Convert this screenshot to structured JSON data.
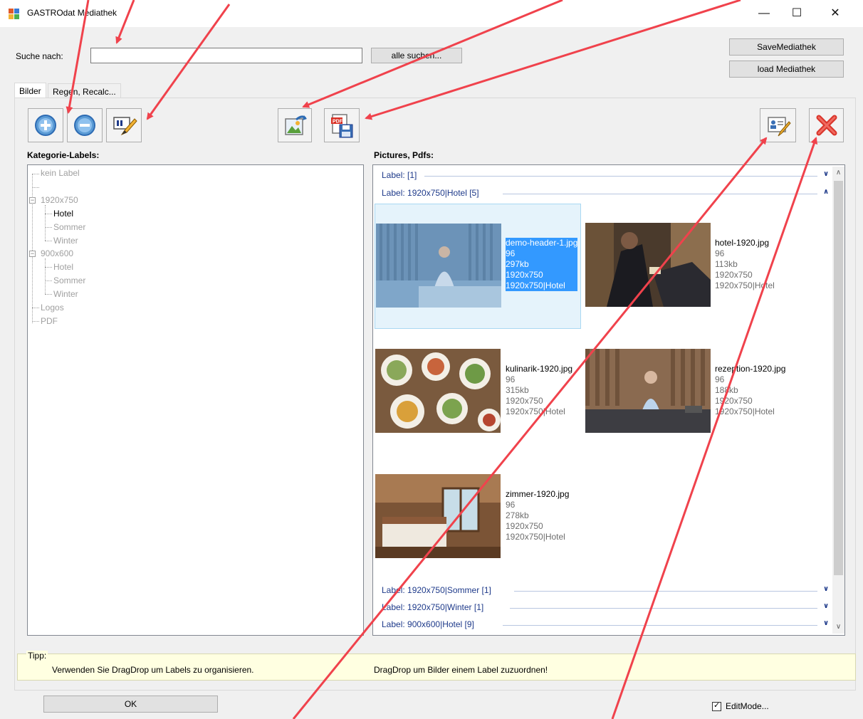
{
  "window": {
    "title": "GASTROdat Mediathek",
    "minimize_glyph": "—",
    "maximize_glyph": "☐",
    "close_glyph": "✕"
  },
  "search": {
    "label": "Suche nach:",
    "value": "",
    "search_all_button": "alle suchen..."
  },
  "top_buttons": {
    "save": "SaveMediathek",
    "load": "load Mediathek"
  },
  "tabs": [
    {
      "label": "Bilder",
      "active": true
    },
    {
      "label": "Regen, Recalc...",
      "active": false
    }
  ],
  "toolbar": {
    "add_icon": "plus-circle-icon",
    "remove_icon": "minus-circle-icon",
    "rename_icon": "ab-pencil-icon",
    "export_image_icon": "image-export-icon",
    "pdf_save_icon": "pdf-save-icon",
    "edit_icon": "edit-user-icon",
    "delete_icon": "red-x-icon"
  },
  "left_panel": {
    "title": "Kategorie-Labels:",
    "tree": [
      {
        "label": "kein Label",
        "selected": false
      },
      {
        "label": "",
        "selected": false
      },
      {
        "label": "1920x750",
        "selected": false
      },
      {
        "label": "Hotel",
        "selected": true
      },
      {
        "label": "Sommer",
        "selected": false
      },
      {
        "label": "Winter",
        "selected": false
      },
      {
        "label": "900x600",
        "selected": false
      },
      {
        "label": "Hotel",
        "selected": false
      },
      {
        "label": "Sommer",
        "selected": false
      },
      {
        "label": "Winter",
        "selected": false
      },
      {
        "label": "Logos",
        "selected": false
      },
      {
        "label": "PDF",
        "selected": false
      }
    ]
  },
  "right_panel": {
    "title": "Pictures, Pdfs:",
    "groups_top": [
      {
        "label": "Label:  [1]",
        "expanded": false
      },
      {
        "label": "Label: 1920x750|Hotel [5]",
        "expanded": true
      }
    ],
    "items": [
      {
        "name": "demo-header-1.jpg",
        "dpi": "96",
        "size": "297kb",
        "dims": "1920x750",
        "label": "1920x750|Hotel",
        "selected": true
      },
      {
        "name": "hotel-1920.jpg",
        "dpi": "96",
        "size": "113kb",
        "dims": "1920x750",
        "label": "1920x750|Hotel",
        "selected": false
      },
      {
        "name": "kulinarik-1920.jpg",
        "dpi": "96",
        "size": "315kb",
        "dims": "1920x750",
        "label": "1920x750|Hotel",
        "selected": false
      },
      {
        "name": "rezeption-1920.jpg",
        "dpi": "96",
        "size": "188kb",
        "dims": "1920x750",
        "label": "1920x750|Hotel",
        "selected": false
      },
      {
        "name": "zimmer-1920.jpg",
        "dpi": "96",
        "size": "278kb",
        "dims": "1920x750",
        "label": "1920x750|Hotel",
        "selected": false
      }
    ],
    "groups_bottom": [
      {
        "label": "Label: 1920x750|Sommer [1]",
        "expanded": false
      },
      {
        "label": "Label: 1920x750|Winter [1]",
        "expanded": false
      },
      {
        "label": "Label: 900x600|Hotel [9]",
        "expanded": false
      }
    ]
  },
  "tip": {
    "title": "Tipp:",
    "left_text": "Verwenden Sie DragDrop um Labels zu organisieren.",
    "right_text": "DragDrop um Bilder einem Label zuzuordnen!"
  },
  "footer": {
    "ok_button": "OK",
    "editmode_label": "EditMode...",
    "editmode_checked": true,
    "check_glyph": "✓"
  },
  "colors": {
    "annotation_arrow": "#f0424c",
    "selection": "#3399ff",
    "group_header": "#1e3a8a",
    "tip_background": "#ffffe1"
  }
}
